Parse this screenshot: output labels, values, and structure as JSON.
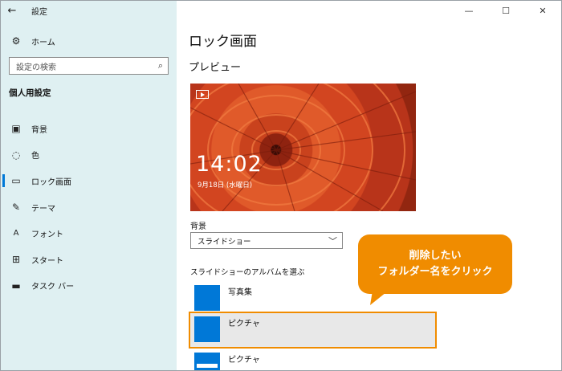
{
  "window": {
    "title": "設定",
    "back_icon": "arrow-left-icon",
    "minimize": "—",
    "maximize": "☐",
    "close": "✕"
  },
  "sidebar": {
    "home": "ホーム",
    "search_placeholder": "設定の検索",
    "section_title": "個人用設定",
    "items": [
      {
        "label": "背景",
        "icon": "picture-icon"
      },
      {
        "label": "色",
        "icon": "palette-icon"
      },
      {
        "label": "ロック画面",
        "icon": "lock-screen-icon",
        "active": true
      },
      {
        "label": "テーマ",
        "icon": "brush-icon"
      },
      {
        "label": "フォント",
        "icon": "font-icon"
      },
      {
        "label": "スタート",
        "icon": "start-icon"
      },
      {
        "label": "タスク バー",
        "icon": "taskbar-icon"
      }
    ]
  },
  "main": {
    "title": "ロック画面",
    "preview_title": "プレビュー",
    "preview_time": "14:02",
    "preview_date": "9月18日 (水曜日)",
    "background_label": "背景",
    "background_value": "スライドショー",
    "album_label": "スライドショーのアルバムを選ぶ",
    "albums": [
      {
        "name": "写真集"
      },
      {
        "name": "ピクチャ",
        "selected": true
      },
      {
        "name": "ピクチャ"
      }
    ]
  },
  "callout": {
    "line1": "削除したい",
    "line2": "フォルダー名をクリック",
    "color": "#f08c00"
  },
  "colors": {
    "sidebar_bg": "#dff0f2",
    "accent": "#0078d7",
    "highlight": "#f08c00"
  }
}
